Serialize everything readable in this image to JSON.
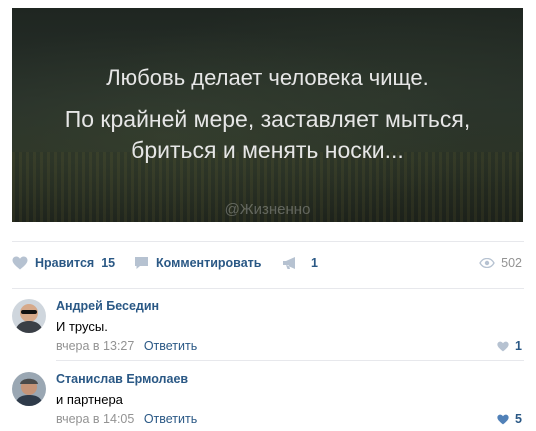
{
  "post": {
    "quote_line1": "Любовь делает человека чище.",
    "quote_line2": "По крайней мере, заставляет мыться, бриться и менять носки...",
    "watermark": "@Жизненно"
  },
  "actions": {
    "like_label": "Нравится",
    "like_count": "15",
    "comment_label": "Комментировать",
    "share_count": "1",
    "views_count": "502"
  },
  "comments": [
    {
      "author": "Андрей Беседин",
      "text": "И трусы.",
      "time": "вчера в 13:27",
      "reply_label": "Ответить",
      "likes": "1",
      "liked": false
    },
    {
      "author": "Станислав Ермолаев",
      "text": "и партнера",
      "time": "вчера в 14:05",
      "reply_label": "Ответить",
      "likes": "5",
      "liked": true
    }
  ],
  "colors": {
    "link": "#2a5885",
    "muted": "#939393",
    "icon": "#b6c2d1",
    "icon_active": "#5181b8"
  }
}
